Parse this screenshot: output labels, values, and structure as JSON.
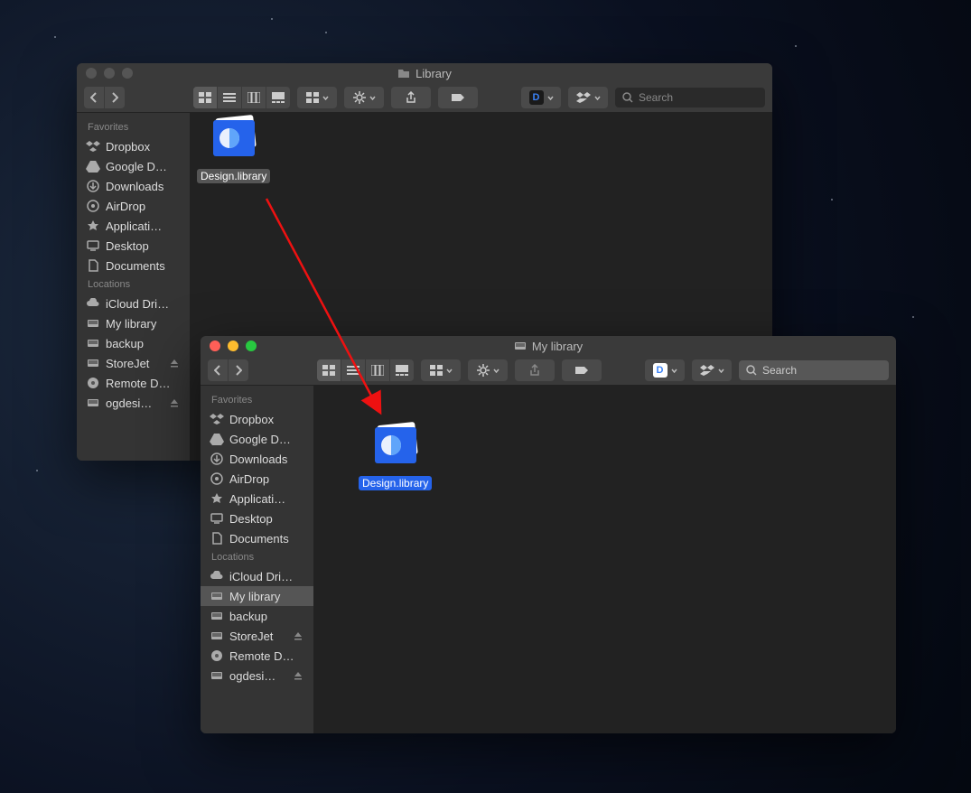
{
  "window1": {
    "title": "Library",
    "search_placeholder": "Search",
    "file_name": "Design.library",
    "sidebar": {
      "favorites_header": "Favorites",
      "favorites": [
        {
          "icon": "dropbox",
          "label": "Dropbox"
        },
        {
          "icon": "gdrive",
          "label": "Google D…"
        },
        {
          "icon": "download",
          "label": "Downloads"
        },
        {
          "icon": "airdrop",
          "label": "AirDrop"
        },
        {
          "icon": "apps",
          "label": "Applicati…"
        },
        {
          "icon": "desktop",
          "label": "Desktop"
        },
        {
          "icon": "docs",
          "label": "Documents"
        }
      ],
      "locations_header": "Locations",
      "locations": [
        {
          "icon": "cloud",
          "label": "iCloud Dri…"
        },
        {
          "icon": "disk",
          "label": "My library"
        },
        {
          "icon": "disk",
          "label": "backup"
        },
        {
          "icon": "disk",
          "label": "StoreJet",
          "eject": true
        },
        {
          "icon": "disc",
          "label": "Remote D…"
        },
        {
          "icon": "disk",
          "label": "ogdesi…",
          "eject": true
        }
      ]
    }
  },
  "window2": {
    "title": "My library",
    "search_placeholder": "Search",
    "file_name": "Design.library",
    "sidebar": {
      "favorites_header": "Favorites",
      "favorites": [
        {
          "icon": "dropbox",
          "label": "Dropbox"
        },
        {
          "icon": "gdrive",
          "label": "Google D…"
        },
        {
          "icon": "download",
          "label": "Downloads"
        },
        {
          "icon": "airdrop",
          "label": "AirDrop"
        },
        {
          "icon": "apps",
          "label": "Applicati…"
        },
        {
          "icon": "desktop",
          "label": "Desktop"
        },
        {
          "icon": "docs",
          "label": "Documents"
        }
      ],
      "locations_header": "Locations",
      "locations": [
        {
          "icon": "cloud",
          "label": "iCloud Dri…"
        },
        {
          "icon": "disk",
          "label": "My library",
          "selected": true
        },
        {
          "icon": "disk",
          "label": "backup"
        },
        {
          "icon": "disk",
          "label": "StoreJet",
          "eject": true
        },
        {
          "icon": "disc",
          "label": "Remote D…"
        },
        {
          "icon": "disk",
          "label": "ogdesi…",
          "eject": true
        }
      ]
    }
  }
}
